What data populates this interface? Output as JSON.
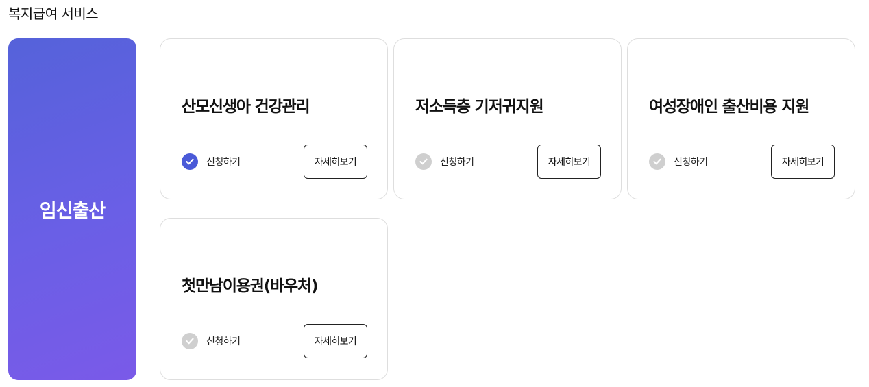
{
  "section": {
    "title": "복지급여 서비스"
  },
  "category": {
    "label": "임신출산",
    "colors": {
      "gradient_start": "#5562da",
      "gradient_end": "#7a5ae8"
    }
  },
  "cards": [
    {
      "title": "산모신생아 건강관리",
      "apply_label": "신청하기",
      "checked": true,
      "detail_label": "자세히보기"
    },
    {
      "title": "저소득층 기저귀지원",
      "apply_label": "신청하기",
      "checked": false,
      "detail_label": "자세히보기"
    },
    {
      "title": "여성장애인 출산비용 지원",
      "apply_label": "신청하기",
      "checked": false,
      "detail_label": "자세히보기"
    },
    {
      "title": "첫만남이용권(바우처)",
      "apply_label": "신청하기",
      "checked": false,
      "detail_label": "자세히보기"
    }
  ],
  "colors": {
    "check_active": "#4a5ad8",
    "check_inactive": "#cfcfcf",
    "card_border": "#dedede"
  },
  "icons": {
    "check": "check-circle-icon"
  }
}
